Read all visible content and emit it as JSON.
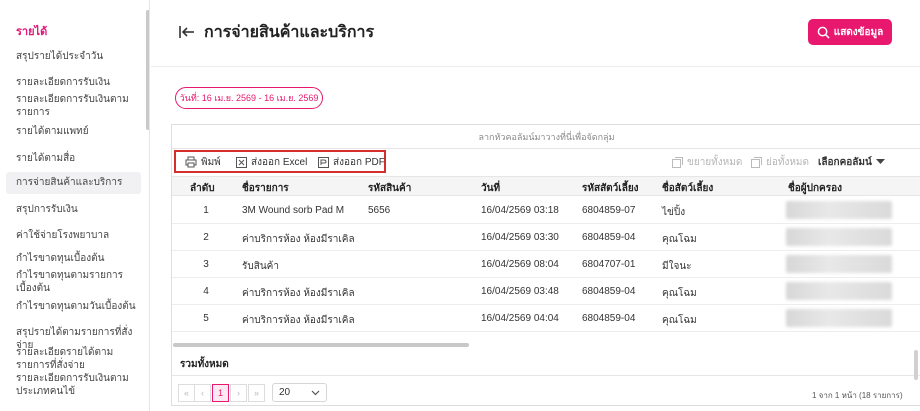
{
  "sidebar": {
    "title": "รายได้",
    "items": [
      {
        "label": "สรุปรายได้ประจำวัน"
      },
      {
        "label": "รายละเอียดการรับเงิน"
      },
      {
        "label": "รายละเอียดการรับเงินตามรายการ"
      },
      {
        "label": "รายได้ตามแพทย์"
      },
      {
        "label": "รายได้ตามสื่อ"
      },
      {
        "label": "การจ่ายสินค้าและบริการ"
      },
      {
        "label": "สรุปการรับเงิน"
      },
      {
        "label": "ค่าใช้จ่ายโรงพยาบาล"
      },
      {
        "label": "กำไรขาดทุนเบื้องต้น"
      },
      {
        "label": "กำไรขาดทุนตามรายการเบื้องต้น"
      },
      {
        "label": "กำไรขาดทุนตามวันเบื้องต้น"
      },
      {
        "label": "สรุปรายได้ตามรายการที่สั่งจ่าย"
      },
      {
        "label": "รายละเอียดรายได้ตามรายการที่สั่งจ่าย"
      },
      {
        "label": "รายละเอียดการรับเงินตามประเภทคนไข้"
      }
    ]
  },
  "header": {
    "title": "การจ่ายสินค้าและบริการ",
    "show_button": "แสดงข้อมูล"
  },
  "filter": {
    "date_chip": "วันที่: 16 เม.ย. 2569 - 16 เม.ย. 2569"
  },
  "grid": {
    "group_hint": "ลากหัวคอลัมน์มาวางที่นี่เพื่อจัดกลุ่ม",
    "toolbar": {
      "print": "พิมพ์",
      "export_excel": "ส่งออก Excel",
      "export_pdf": "ส่งออก PDF",
      "expand_all": "ขยายทั้งหมด",
      "collapse_all": "ย่อทั้งหมด",
      "choose_columns": "เลือกคอลัมน์"
    },
    "columns": [
      "ลำดับ",
      "ชื่อรายการ",
      "รหัสสินค้า",
      "วันที่",
      "รหัสสัตว์เลี้ยง",
      "ชื่อสัตว์เลี้ยง",
      "ชื่อผู้ปกครอง"
    ],
    "rows": [
      {
        "no": "1",
        "name": "3M Wound sorb Pad M",
        "code": "5656",
        "date": "16/04/2569 03:18",
        "pet_id": "6804859-07",
        "pet_name": "ไข่ปิ้ง"
      },
      {
        "no": "2",
        "name": "ค่าบริการห้อง ห้องมีราเคิล",
        "code": "",
        "date": "16/04/2569 03:30",
        "pet_id": "6804859-04",
        "pet_name": "คุณโฉม"
      },
      {
        "no": "3",
        "name": "รับสินค้า",
        "code": "",
        "date": "16/04/2569 08:04",
        "pet_id": "6804707-01",
        "pet_name": "มีใจนะ"
      },
      {
        "no": "4",
        "name": "ค่าบริการห้อง ห้องมีราเคิล",
        "code": "",
        "date": "16/04/2569 03:48",
        "pet_id": "6804859-04",
        "pet_name": "คุณโฉม"
      },
      {
        "no": "5",
        "name": "ค่าบริการห้อง ห้องมีราเคิล",
        "code": "",
        "date": "16/04/2569 04:04",
        "pet_id": "6804859-04",
        "pet_name": "คุณโฉม"
      }
    ],
    "summary": "รวมทั้งหมด",
    "pager": {
      "first": "«",
      "prev": "‹",
      "current": "1",
      "next": "›",
      "last": "»",
      "page_size": "20",
      "info": "1 จาก 1 หน้า (18 รายการ)"
    }
  },
  "colors": {
    "accent": "#e8186e",
    "highlight_box": "#d62d2d"
  }
}
